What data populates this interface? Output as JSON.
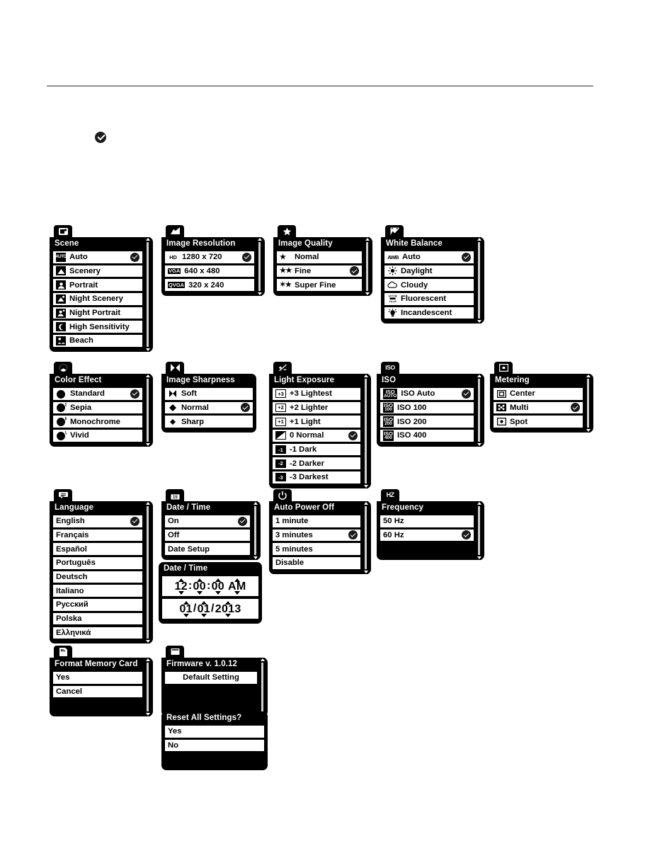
{
  "page": {
    "legend_icon": "check-badge-icon"
  },
  "menus": [
    {
      "id": "scene",
      "tab_icon": "scene-mode-icon",
      "title": "Scene",
      "scrollbar": true,
      "items": [
        {
          "icon": "auto-icon",
          "label": "Auto",
          "selected": true
        },
        {
          "icon": "scenery-icon",
          "label": "Scenery",
          "selected": false
        },
        {
          "icon": "portrait-icon",
          "label": "Portrait",
          "selected": false
        },
        {
          "icon": "night-scenery-icon",
          "label": "Night Scenery",
          "selected": false
        },
        {
          "icon": "night-portrait-icon",
          "label": "Night Portrait",
          "selected": false
        },
        {
          "icon": "high-sensitivity-icon",
          "label": "High Sensitivity",
          "selected": false
        },
        {
          "icon": "beach-icon",
          "label": "Beach",
          "selected": false
        }
      ]
    },
    {
      "id": "image-resolution",
      "tab_icon": "image-resolution-icon",
      "title": "Image Resolution",
      "scrollbar": true,
      "items": [
        {
          "chip": "HD",
          "label": "1280 x 720",
          "selected": true
        },
        {
          "chip": "VGA",
          "label": "640 x 480",
          "selected": false
        },
        {
          "chip": "QVGA",
          "label": "320 x 240",
          "selected": false
        }
      ]
    },
    {
      "id": "image-quality",
      "tab_icon": "star-icon",
      "title": "Image Quality",
      "scrollbar": true,
      "items": [
        {
          "stars": "★",
          "label": "Nomal",
          "selected": false
        },
        {
          "stars": "★★",
          "label": "Fine",
          "selected": true
        },
        {
          "stars": "✶★",
          "label": "Super Fine",
          "selected": false
        }
      ]
    },
    {
      "id": "white-balance",
      "tab_icon": "white-balance-icon",
      "title": "White Balance",
      "scrollbar": true,
      "items": [
        {
          "icon": "awb-icon",
          "label": "Auto",
          "selected": true
        },
        {
          "icon": "daylight-icon",
          "label": "Daylight",
          "selected": false
        },
        {
          "icon": "cloudy-icon",
          "label": "Cloudy",
          "selected": false
        },
        {
          "icon": "fluorescent-icon",
          "label": "Fluorescent",
          "selected": false
        },
        {
          "icon": "incandescent-icon",
          "label": "Incandescent",
          "selected": false
        }
      ]
    },
    {
      "id": "color-effect",
      "tab_icon": "color-effect-icon",
      "title": "Color Effect",
      "scrollbar": true,
      "items": [
        {
          "icon": "color-standard-icon",
          "label": "Standard",
          "selected": true
        },
        {
          "icon": "color-sepia-icon",
          "label": "Sepia",
          "selected": false
        },
        {
          "icon": "color-monochrome-icon",
          "label": "Monochrome",
          "selected": false
        },
        {
          "icon": "color-vivid-icon",
          "label": "Vivid",
          "selected": false
        }
      ]
    },
    {
      "id": "image-sharpness",
      "tab_icon": "sharpness-icon",
      "title": "Image Sharpness",
      "scrollbar": false,
      "items": [
        {
          "icon": "sharpness-soft-icon",
          "label": "Soft",
          "selected": false
        },
        {
          "icon": "sharpness-normal-icon",
          "label": "Normal",
          "selected": true
        },
        {
          "icon": "sharpness-sharp-icon",
          "label": "Sharp",
          "selected": false
        }
      ]
    },
    {
      "id": "light-exposure",
      "tab_icon": "exposure-icon",
      "title": "Light Exposure",
      "scrollbar": true,
      "items": [
        {
          "ev": "+3",
          "label": "+3 Lightest",
          "selected": false
        },
        {
          "ev": "+2",
          "label": "+2 Lighter",
          "selected": false
        },
        {
          "ev": "+1",
          "label": "+1 Light",
          "selected": false
        },
        {
          "ev": "0",
          "label": "0 Normal",
          "selected": true
        },
        {
          "ev": "-1",
          "label": "-1 Dark",
          "selected": false
        },
        {
          "ev": "-2",
          "label": "-2 Darker",
          "selected": false
        },
        {
          "ev": "-3",
          "label": "-3 Darkest",
          "selected": false
        }
      ]
    },
    {
      "id": "iso",
      "tab_icon": "iso-icon",
      "title": "ISO",
      "scrollbar": true,
      "items": [
        {
          "chip_top": "ISO",
          "chip_bot": "AUTO",
          "label": "ISO Auto",
          "selected": true
        },
        {
          "chip_top": "ISO",
          "chip_bot": "100",
          "label": "ISO 100",
          "selected": false
        },
        {
          "chip_top": "ISO",
          "chip_bot": "200",
          "label": "ISO 200",
          "selected": false
        },
        {
          "chip_top": "ISO",
          "chip_bot": "400",
          "label": "ISO 400",
          "selected": false
        }
      ]
    },
    {
      "id": "metering",
      "tab_icon": "metering-icon",
      "title": "Metering",
      "scrollbar": true,
      "items": [
        {
          "icon": "metering-center-icon",
          "label": "Center",
          "selected": false
        },
        {
          "icon": "metering-multi-icon",
          "label": "Multi",
          "selected": true
        },
        {
          "icon": "metering-spot-icon",
          "label": "Spot",
          "selected": false
        }
      ]
    },
    {
      "id": "language",
      "tab_icon": "language-icon",
      "title": "Language",
      "scrollbar": true,
      "items": [
        {
          "label": "English",
          "selected": true
        },
        {
          "label": "Français",
          "selected": false
        },
        {
          "label": "Español",
          "selected": false
        },
        {
          "label": "Português",
          "selected": false
        },
        {
          "label": "Deutsch",
          "selected": false
        },
        {
          "label": "Italiano",
          "selected": false
        },
        {
          "label": "Русский",
          "selected": false
        },
        {
          "label": "Polska",
          "selected": false
        },
        {
          "label": "Ελληνικά",
          "selected": false
        }
      ]
    },
    {
      "id": "date-time",
      "tab_icon": "calendar-icon",
      "title": "Date / Time",
      "scrollbar": true,
      "items": [
        {
          "label": "On",
          "selected": true
        },
        {
          "label": "Off",
          "selected": false
        },
        {
          "label": "Date Setup",
          "selected": false
        }
      ]
    },
    {
      "id": "auto-power-off",
      "tab_icon": "power-icon",
      "title": "Auto Power Off",
      "scrollbar": true,
      "items": [
        {
          "label": "1 minute",
          "selected": false
        },
        {
          "label": "3 minutes",
          "selected": true
        },
        {
          "label": "5 minutes",
          "selected": false
        },
        {
          "label": "Disable",
          "selected": false
        }
      ]
    },
    {
      "id": "frequency",
      "tab_icon": "hz-icon",
      "title": "Frequency",
      "scrollbar": true,
      "items": [
        {
          "label": "50 Hz",
          "selected": false
        },
        {
          "label": "60 Hz",
          "selected": true
        }
      ]
    },
    {
      "id": "format-memory-card",
      "tab_icon": "memory-card-icon",
      "title": "Format Memory Card",
      "scrollbar": true,
      "items": [
        {
          "label": "Yes",
          "selected": false
        },
        {
          "label": "Cancel",
          "selected": false
        }
      ]
    },
    {
      "id": "firmware",
      "tab_icon": "firmware-icon",
      "title": "Firmware v. 1.0.12",
      "scrollbar": true,
      "items": [
        {
          "label": "Default Setting",
          "selected": false,
          "center": true
        }
      ]
    },
    {
      "id": "reset-all-settings",
      "tab_icon": null,
      "title": "Reset All Settings?",
      "scrollbar": false,
      "items": [
        {
          "label": "Yes",
          "selected": false
        },
        {
          "label": "No",
          "selected": false
        }
      ]
    }
  ],
  "date_time_setup": {
    "title": "Date / Time",
    "time": {
      "hour": "12",
      "minute": "00",
      "second": "00",
      "meridiem": "AM",
      "sep": ":"
    },
    "date": {
      "month": "01",
      "day": "01",
      "year": "2013",
      "sep": "/"
    }
  }
}
